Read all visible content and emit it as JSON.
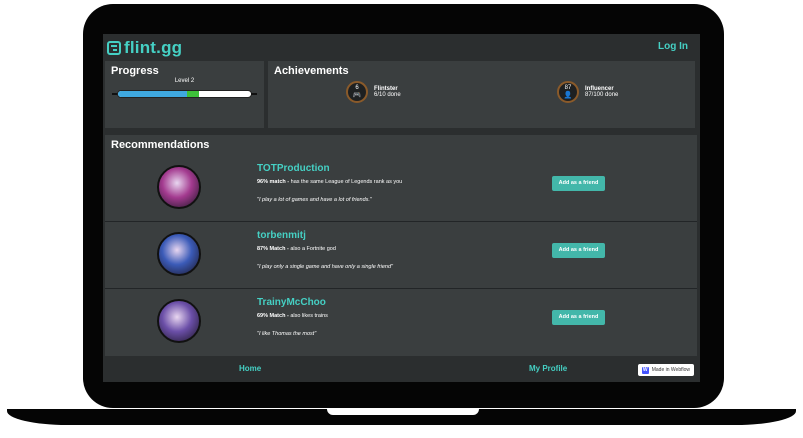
{
  "app": {
    "logo_text": "flint.gg",
    "login_label": "Log In"
  },
  "progress": {
    "title": "Progress",
    "level_label": "Level 2",
    "fill_blue_pct": 52,
    "fill_green_pct": 9
  },
  "achievements": {
    "title": "Achievements",
    "items": [
      {
        "badge_value": "6",
        "icon": "gamepad-icon",
        "name": "Flintster",
        "count": "6/10 done"
      },
      {
        "badge_value": "87",
        "icon": "person-icon",
        "name": "Influencer",
        "count": "87/100 done"
      }
    ]
  },
  "recommendations": {
    "title": "Recommendations",
    "button_label": "Add as a friend",
    "items": [
      {
        "name": "TOTProduction",
        "match_strong": "96% match -",
        "match_rest": " has the same League of Legends rank as you",
        "quote": "\"I play a lot of games and have a lot of friends.\"",
        "avatar_color": "#a33a8f"
      },
      {
        "name": "torbenmitj",
        "match_strong": "87% Match -",
        "match_rest": " also a Fortnite god",
        "quote": "\"I play only a single game and have only a single friend\"",
        "avatar_color": "#3b5bb8"
      },
      {
        "name": "TrainyMcChoo",
        "match_strong": "69% Match -",
        "match_rest": " also likes trains",
        "quote": "\"I like Thomas the most\"",
        "avatar_color": "#6b4fa8"
      }
    ]
  },
  "footer": {
    "home_label": "Home",
    "profile_label": "My Profile",
    "webflow_label": "Made in Webflow"
  },
  "colors": {
    "accent": "#45d0c4",
    "panel": "#3a3e3f",
    "background": "#2b2e2f",
    "button": "#43b7aa"
  }
}
